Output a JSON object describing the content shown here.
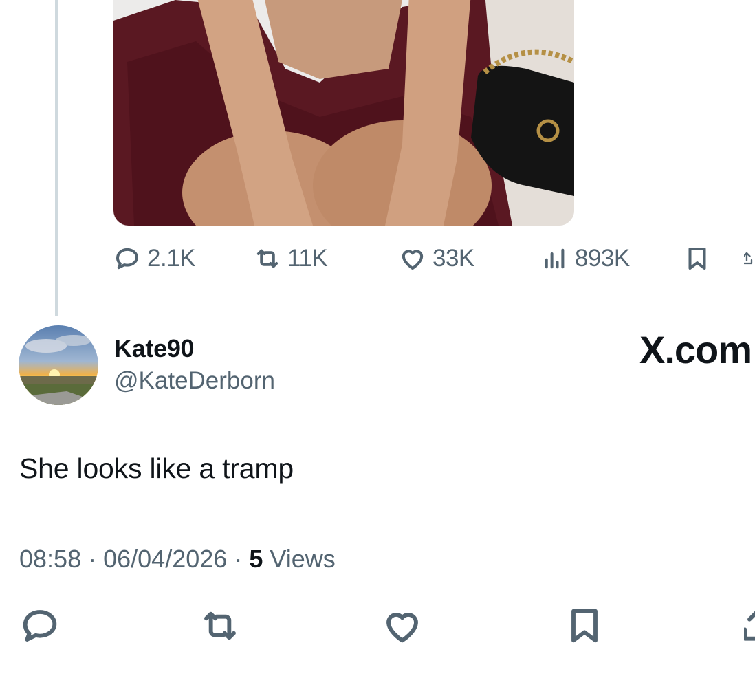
{
  "parent_tweet": {
    "actions": {
      "replies": "2.1K",
      "reposts": "11K",
      "likes": "33K",
      "views": "893K"
    }
  },
  "reply": {
    "display_name": "Kate90",
    "handle": "@KateDerborn",
    "text": "She looks like a tramp",
    "time": "08:58",
    "date": "06/04/2026",
    "views_count": "5",
    "views_label": "Views"
  },
  "brand": {
    "logo_text": "X.com"
  },
  "icons": [
    "reply-icon",
    "repost-icon",
    "like-icon",
    "views-icon",
    "bookmark-icon",
    "share-icon"
  ],
  "colors": {
    "text_primary": "#0f1419",
    "text_secondary": "#536471",
    "thread_line": "#cfd9de"
  }
}
